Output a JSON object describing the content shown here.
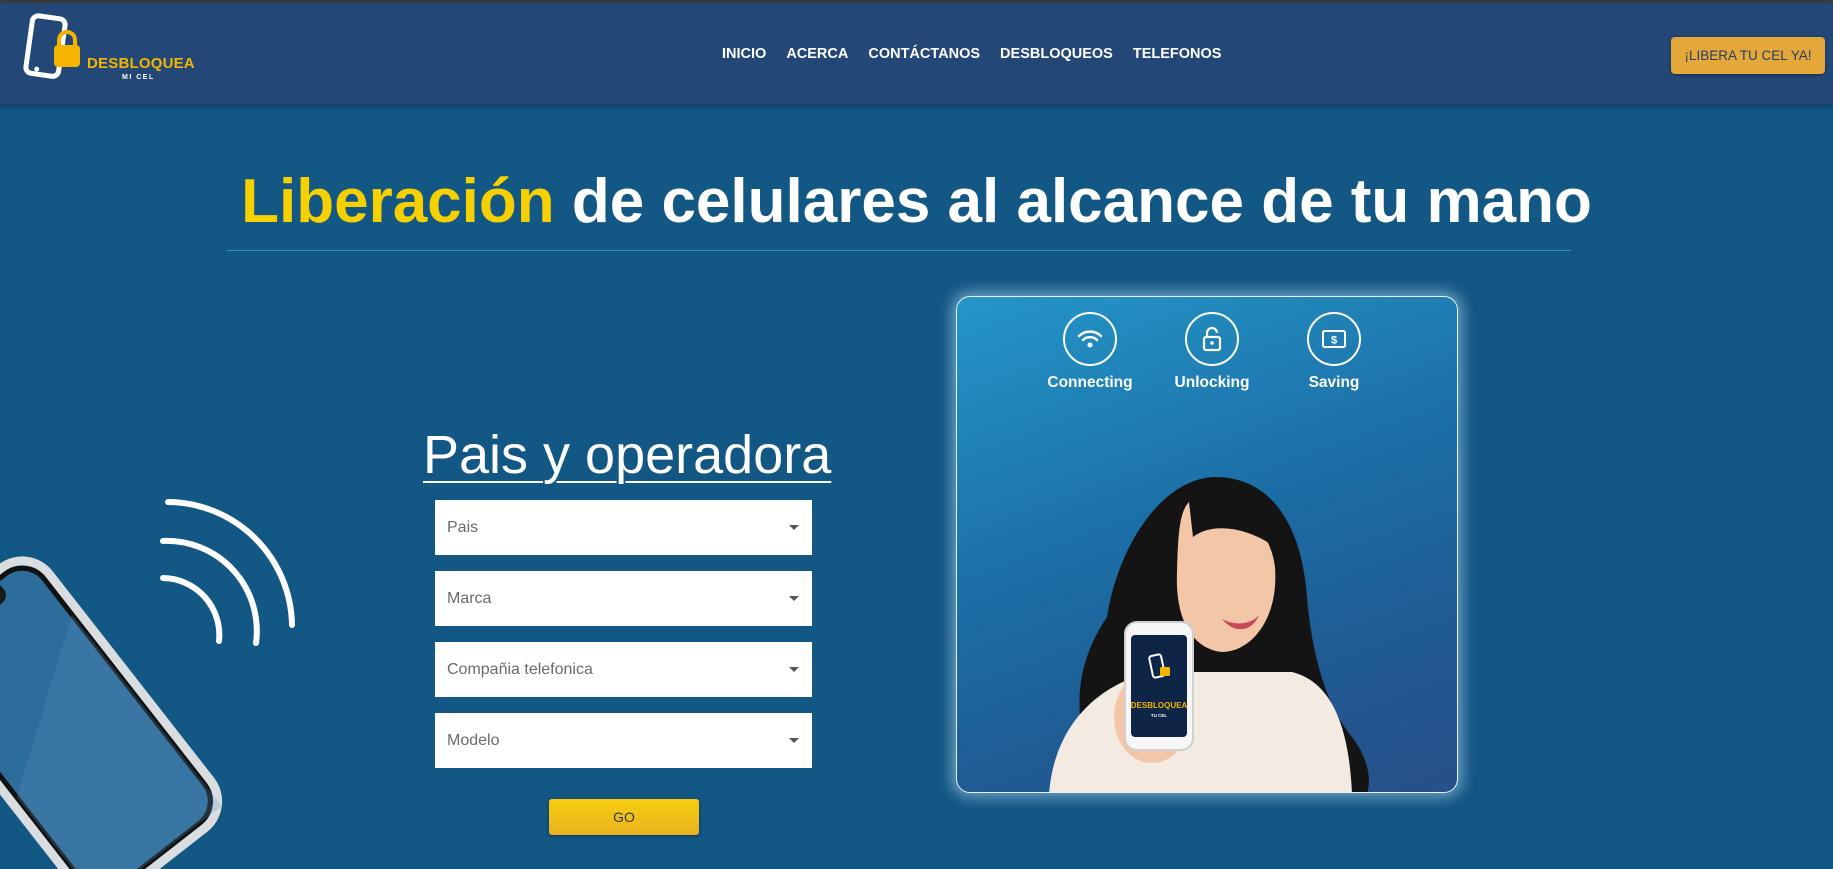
{
  "header": {
    "logo": {
      "name": "DESBLOQUEA",
      "tagline": "MI CEL"
    },
    "nav": [
      "INICIO",
      "ACERCA",
      "CONTÁCTANOS",
      "DESBLOQUEOS",
      "TELEFONOS"
    ],
    "cta_label": "¡LIBERA TU CEL YA!"
  },
  "hero": {
    "title_highlight": "Liberación",
    "title_rest": " de celulares al alcance de tu mano"
  },
  "form": {
    "title": "Pais y operadora",
    "selects": [
      {
        "placeholder": "Pais"
      },
      {
        "placeholder": "Marca"
      },
      {
        "placeholder": "Compañia telefonica"
      },
      {
        "placeholder": "Modelo"
      }
    ],
    "submit_label": "GO"
  },
  "card": {
    "features": [
      {
        "label": "Connecting",
        "icon": "wifi-icon"
      },
      {
        "label": "Unlocking",
        "icon": "lock-icon"
      },
      {
        "label": "Saving",
        "icon": "money-icon"
      }
    ],
    "phone_screen": {
      "name": "DESBLOQUEA",
      "tagline": "TU CEL"
    }
  },
  "colors": {
    "header_bg": "#234877",
    "page_bg": "#135784",
    "accent_yellow": "#f6d000",
    "cta_orange": "#e3a73a"
  }
}
